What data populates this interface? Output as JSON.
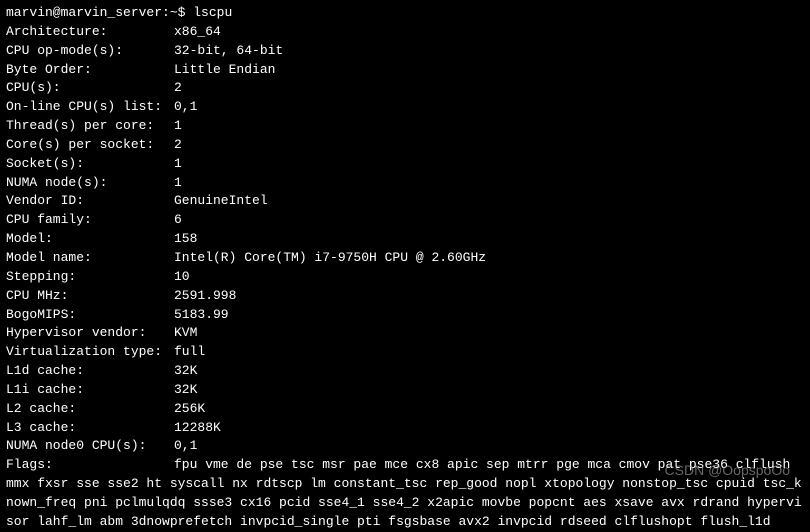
{
  "prompt": {
    "user_host": "marvin@marvin_server",
    "path": ":~$ ",
    "command": "lscpu"
  },
  "rows": [
    {
      "label": "Architecture:",
      "value": "x86_64"
    },
    {
      "label": "CPU op-mode(s):",
      "value": "32-bit, 64-bit"
    },
    {
      "label": "Byte Order:",
      "value": "Little Endian"
    },
    {
      "label": "CPU(s):",
      "value": "2"
    },
    {
      "label": "On-line CPU(s) list:",
      "value": "0,1"
    },
    {
      "label": "Thread(s) per core:",
      "value": "1"
    },
    {
      "label": "Core(s) per socket:",
      "value": "2"
    },
    {
      "label": "Socket(s):",
      "value": "1"
    },
    {
      "label": "NUMA node(s):",
      "value": "1"
    },
    {
      "label": "Vendor ID:",
      "value": "GenuineIntel"
    },
    {
      "label": "CPU family:",
      "value": "6"
    },
    {
      "label": "Model:",
      "value": "158"
    },
    {
      "label": "Model name:",
      "value": "Intel(R) Core(TM) i7-9750H CPU @ 2.60GHz"
    },
    {
      "label": "Stepping:",
      "value": "10"
    },
    {
      "label": "CPU MHz:",
      "value": "2591.998"
    },
    {
      "label": "BogoMIPS:",
      "value": "5183.99"
    },
    {
      "label": "Hypervisor vendor:",
      "value": "KVM"
    },
    {
      "label": "Virtualization type:",
      "value": "full"
    },
    {
      "label": "L1d cache:",
      "value": "32K"
    },
    {
      "label": "L1i cache:",
      "value": "32K"
    },
    {
      "label": "L2 cache:",
      "value": "256K"
    },
    {
      "label": "L3 cache:",
      "value": "12288K"
    },
    {
      "label": "NUMA node0 CPU(s):",
      "value": "0,1"
    }
  ],
  "flags": {
    "label": "Flags:",
    "value": "fpu vme de pse tsc msr pae mce cx8 apic sep mtrr pge mca cmov pat pse36 clflush mmx fxsr sse sse2 ht syscall nx rdtscp lm constant_tsc rep_good nopl xtopology nonstop_tsc cpuid tsc_known_freq pni pclmulqdq ssse3 cx16 pcid sse4_1 sse4_2 x2apic movbe popcnt aes xsave avx rdrand hypervisor lahf_lm abm 3dnowprefetch invpcid_single pti fsgsbase avx2 invpcid rdseed clflushopt flush_l1d"
  },
  "watermark": "CSDN @OopspoOo"
}
